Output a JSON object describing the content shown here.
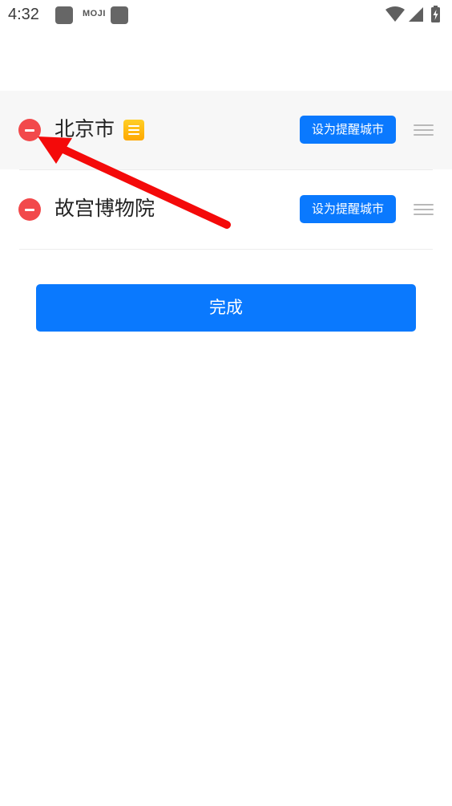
{
  "status_bar": {
    "time": "4:32",
    "notification_label": "MOJI",
    "icons": [
      "wifi-icon",
      "cell-signal-icon",
      "battery-charging-icon"
    ]
  },
  "cities": [
    {
      "name": "北京市",
      "badge_icon": "list-icon",
      "action_label": "设为提醒城市"
    },
    {
      "name": "故宫博物院",
      "action_label": "设为提醒城市"
    }
  ],
  "done_label": "完成",
  "colors": {
    "accent": "#0a79fe",
    "remove": "#f2494b",
    "badge": "#ffb800",
    "annotation": "#f40a0a",
    "row_highlight": "#f7f7f7"
  }
}
